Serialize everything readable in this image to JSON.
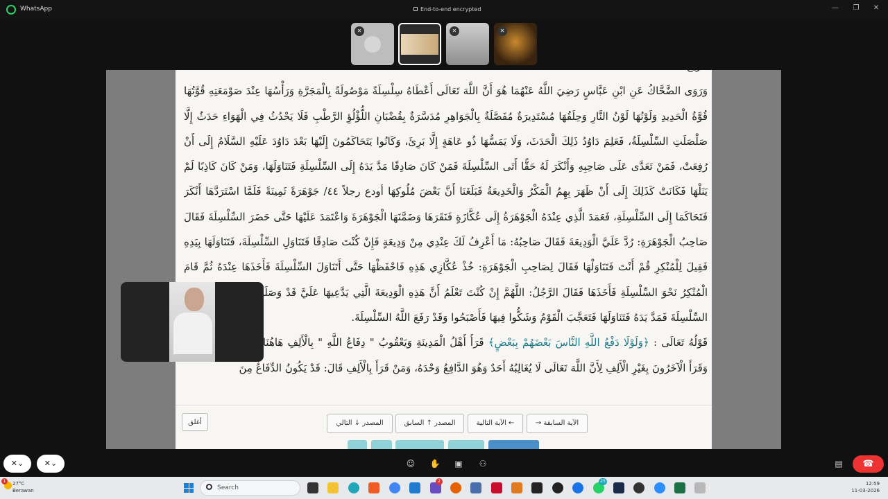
{
  "window": {
    "app_name": "WhatsApp",
    "encryption_note": "End-to-end encrypted"
  },
  "participants": [
    {
      "muted": true,
      "type": "avatar-placeholder"
    },
    {
      "muted": false,
      "type": "screen-share",
      "active": true
    },
    {
      "muted": true,
      "type": "camera"
    },
    {
      "muted": true,
      "type": "camera"
    }
  ],
  "document": {
    "top_fragment": "الرِّيحُ.",
    "paragraphs": [
      "وَرَوَى الضَّحَّاكُ عَنِ ابْنِ عَبَّاسٍ رَضِيَ اللَّهُ عَنْهُمَا هُوَ أَنَّ اللَّهَ تَعَالَى أَعْطَاهُ سِلْسِلَةً مَوْصُولَةً بِالْمَجَرَّةِ وَرَأْسُهَا عِنْدَ صَوْمَعَتِهِ قُوَّتُهَا قُوَّةُ الْحَدِيدِ وَلَوْنُهَا لَوْنُ النَّارِ وَحِلَقُهَا مُسْتَدِيرَةٌ مُفَصَّلَةٌ بِالْجَوَاهِرِ مُدَسَّرَةٌ بِقُضْبَانِ اللُّؤْلُؤِ الرَّطْبِ فَلَا يَحْدُثُ فِي الْهَوَاءِ حَدَثٌ إِلَّا صَلْصَلَتِ السِّلْسِلَةُ، فَعَلِمَ دَاوُدُ ذَلِكَ الْحَدَثَ، وَلَا يَمَسُّهَا ذُو عَاهَةٍ إِلَّا بَرِئَ، وَكَانُوا يَتَحَاكَمُونَ إِلَيْهَا بَعْدَ دَاوُدَ عَلَيْهِ السَّلَامُ إِلَى أَنْ رُفِعَتْ، فَمَنْ تَعَدَّى عَلَى صَاحِبِهِ وَأَنْكَرَ لَهُ حَقًّا أَتَى السِّلْسِلَةَ فَمَنْ كَانَ صَادِقًا مَدَّ يَدَهُ إِلَى السِّلْسِلَةِ فَتَنَاوَلَهَا، وَمَنْ كَانَ كَاذِبًا لَمْ يَنَلْهَا فَكَانَتْ كَذَلِكَ إِلَى أَنْ ظَهَرَ بِهِمُ الْمَكْرُ وَالْخَدِيعَةُ فَبَلَغَنَا أَنَّ بَعْضَ مُلُوكِهَا أودع رجلاً ٤٤/ جَوْهَرَةً ثَمِينَةً فَلَمَّا اسْتَرَدَّهَا أَنْكَرَ فَتَحَاكَمَا إِلَى السِّلْسِلَةِ، فَعَمَدَ الَّذِي عِنْدَهُ الْجَوْهَرَةُ إِلَى عُكَّازَةٍ فَنَقَرَهَا وَضَمَّنَهَا الْجَوْهَرَةَ وَاعْتَمَدَ عَلَيْهَا حَتَّى حَضَرَ السِّلْسِلَةَ فَقَالَ صَاحِبُ الْجَوْهَرَةِ: رُدَّ عَلَيَّ الْوَدِيعَةَ فَقَالَ صَاحِبُهُ: مَا أَعْرِفُ لَكَ عِنْدِي مِنْ وَدِيعَةٍ فَإِنْ كُنْتَ صَادِقًا فَتَنَاوَلِ السِّلْسِلَةَ، فَتَنَاوَلَهَا بِيَدِهِ فَقِيلَ لِلْمُنْكِرِ قُمْ أَنْتَ فَتَنَاوَلْهَا فَقَالَ لِصَاحِبِ الْجَوْهَرَةِ: خُذْ عُكَّازِي هَذِهِ فَاحْفَظْهَا حَتَّى أَتَنَاوَلَ السِّلْسِلَةَ فَأَخَذَهَا عِنْدَهُ ثُمَّ قَامَ الْمُنْكِرُ نَحْوَ السِّلْسِلَةِ فَأَخَذَهَا فَقَالَ الرَّجُلُ: اللَّهُمَّ إِنْ كُنْتَ تَعْلَمُ أَنَّ هَذِهِ الْوَدِيعَةَ الَّتِي يَدَّعِيهَا عَلَيَّ قَدْ وَصَلَتْ إِلَيْهِ فَقَرِّبْ مِنِّي السِّلْسِلَةَ فَمَدَّ يَدَهُ فَتَنَاوَلَهَا فَتَعَجَّبَ الْقَوْمُ وَشَكُّوا فِيهَا فَأَصْبَحُوا وَقَدْ رَفَعَ اللَّهُ السِّلْسِلَةَ."
    ],
    "quote_intro": "قَوْلُهُ تَعَالَى :",
    "quran_verse": "﴿وَلَوْلَا دَفْعُ اللَّهِ النَّاسَ بَعْضَهُمْ بِبَعْضٍ﴾",
    "quote_rest": "قَرَأَ أَهْلُ الْمَدِينَةِ وَيَعْقُوبُ \" دِفَاعُ اللَّهِ \" بِالْأَلِفِ هَاهُنَا وَفِي سُورَةِ الْحَجِّ، وَقَرَأَ الْآخَرُونَ بِغَيْرِ الْأَلِفِ لِأَنَّ اللَّهَ تَعَالَى لَا يُغَالِبُهُ أَحَدٌ وَهُوَ الدَّافِعُ وَحْدَهُ، وَمَنْ قَرَأَ بِالْأَلِفِ قَالَ: قَدْ يَكُونُ الدِّفَاعُ مِنَ"
  },
  "nav": {
    "close": "أغلق",
    "next_source": "المصدر ↓ التالي",
    "prev_source": "المصدر ↑ السابق",
    "next_verse": "الآية التالية ←",
    "prev_verse": "→ الآية السابقة"
  },
  "callbar": {
    "camera_off": true,
    "mic_muted": true
  },
  "taskbar": {
    "temperature": "27°C",
    "weather": "Berawan",
    "weather_badge": "1",
    "search_placeholder": "Search",
    "badge_a": "2",
    "badge_b": "25",
    "time": "12:59",
    "date": "11-03-2026"
  },
  "colors": {
    "quran_text": "#1f7a8c",
    "end_call": "#e33333",
    "whatsapp_green": "#25d366",
    "accent_tab": "#4a8fc7"
  }
}
